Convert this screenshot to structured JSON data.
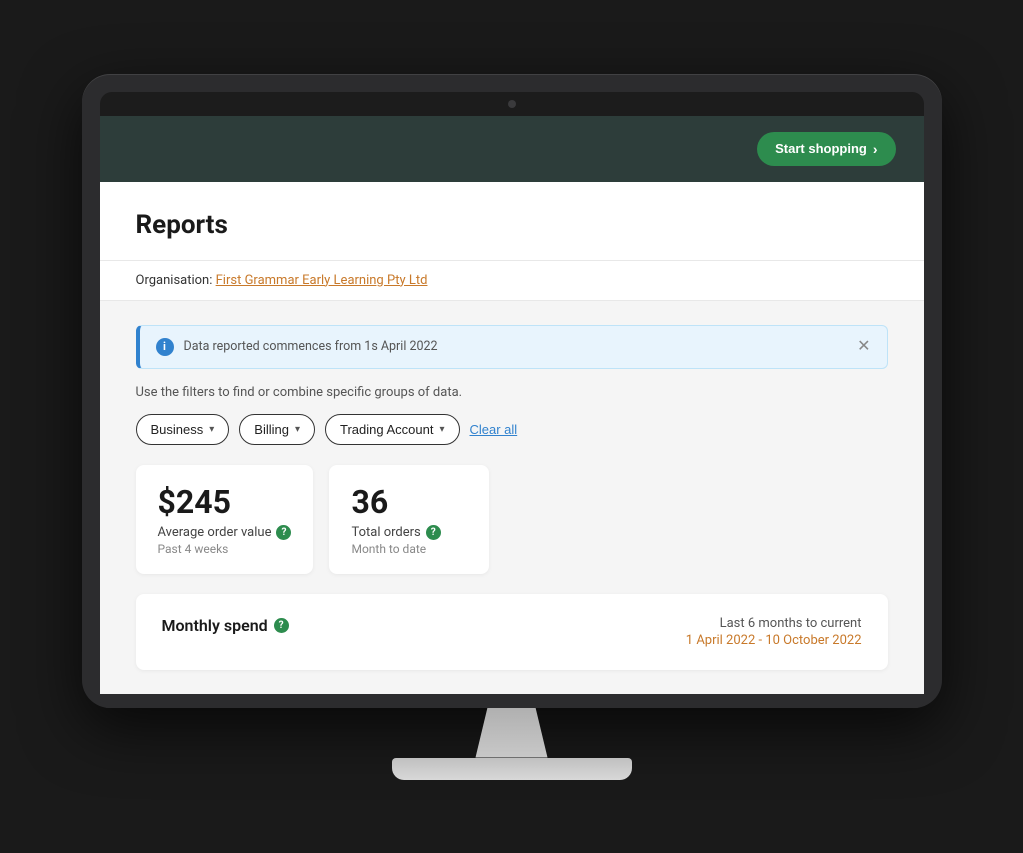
{
  "navbar": {
    "start_shopping_label": "Start shopping",
    "start_shopping_arrow": "›"
  },
  "page": {
    "title": "Reports"
  },
  "org": {
    "label": "Organisation:",
    "name": "First Grammar Early Learning Pty Ltd"
  },
  "info_banner": {
    "text_prefix": "Data reported commences from 1s April 2022",
    "link_text": ""
  },
  "filter_hint": "Use the filters to find or combine specific groups of data.",
  "filters": [
    {
      "label": "Business",
      "id": "business-filter"
    },
    {
      "label": "Billing",
      "id": "billing-filter"
    },
    {
      "label": "Trading Account",
      "id": "trading-account-filter"
    }
  ],
  "clear_all": "Clear all",
  "stats": [
    {
      "value": "$245",
      "label": "Average order value",
      "sublabel": "Past 4 weeks",
      "help": true
    },
    {
      "value": "36",
      "label": "Total orders",
      "sublabel": "Month to date",
      "help": true
    }
  ],
  "monthly_spend": {
    "title": "Monthly spend",
    "help": true,
    "range_label": "Last 6 months to current",
    "range_dates": "1 April 2022 - 10 October 2022"
  }
}
